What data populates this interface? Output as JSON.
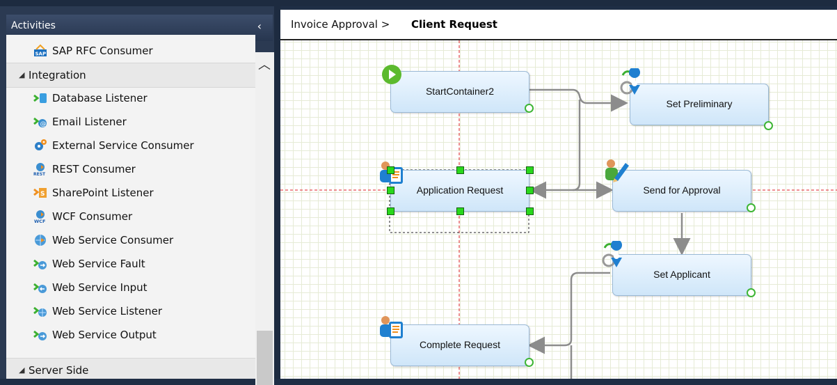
{
  "sidebar": {
    "title": "Activities",
    "collapse_glyph": "‹",
    "items": [
      {
        "type": "item",
        "label": "SAP RFC Consumer",
        "icon": "sap-icon"
      },
      {
        "type": "group",
        "label": "Integration"
      },
      {
        "type": "item",
        "label": "Database Listener",
        "icon": "database-listener-icon"
      },
      {
        "type": "item",
        "label": "Email Listener",
        "icon": "email-listener-icon"
      },
      {
        "type": "item",
        "label": "External Service Consumer",
        "icon": "external-service-icon"
      },
      {
        "type": "item",
        "label": "REST Consumer",
        "icon": "rest-icon"
      },
      {
        "type": "item",
        "label": "SharePoint Listener",
        "icon": "sharepoint-icon"
      },
      {
        "type": "item",
        "label": "WCF Consumer",
        "icon": "wcf-icon"
      },
      {
        "type": "item",
        "label": "Web Service Consumer",
        "icon": "web-service-consumer-icon"
      },
      {
        "type": "item",
        "label": "Web Service Fault",
        "icon": "web-service-fault-icon"
      },
      {
        "type": "item",
        "label": "Web Service Input",
        "icon": "web-service-input-icon"
      },
      {
        "type": "item",
        "label": "Web Service Listener",
        "icon": "web-service-listener-icon"
      },
      {
        "type": "item",
        "label": "Web Service Output",
        "icon": "web-service-output-icon"
      },
      {
        "type": "group",
        "label": "Server Side"
      }
    ]
  },
  "breadcrumb": {
    "parent": "Invoice Approval >",
    "current": "Client Request"
  },
  "workflow": {
    "nodes": [
      {
        "label": "StartContainer2",
        "icon": "play-icon"
      },
      {
        "label": "Set Preliminary",
        "icon": "set-location-icon"
      },
      {
        "label": "Application Request",
        "icon": "user-form-icon",
        "selected": true
      },
      {
        "label": "Send for Approval",
        "icon": "user-edit-icon"
      },
      {
        "label": "Set Applicant",
        "icon": "set-location-icon"
      },
      {
        "label": "Complete Request",
        "icon": "user-form-icon"
      }
    ]
  },
  "colors": {
    "frame": "#1f2e45",
    "guide": "#e0202a",
    "handle": "#29d81c",
    "port": "#3db534",
    "connector": "#8c8c8c"
  }
}
